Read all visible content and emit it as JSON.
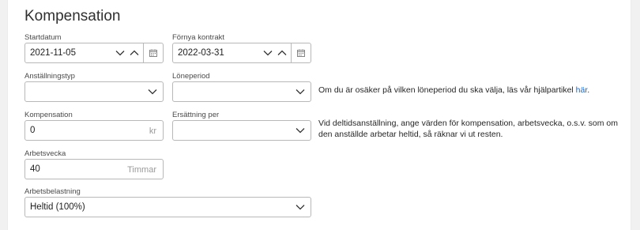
{
  "section": {
    "title": "Kompensation"
  },
  "fields": {
    "startdatum": {
      "label": "Startdatum",
      "value": "2021-11-05"
    },
    "fornya_kontrakt": {
      "label": "Förnya kontrakt",
      "value": "2022-03-31"
    },
    "anstallningstyp": {
      "label": "Anställningstyp",
      "value": ""
    },
    "loneperiod": {
      "label": "Löneperiod",
      "value": ""
    },
    "kompensation": {
      "label": "Kompensation",
      "value": "0",
      "suffix": "kr"
    },
    "ersattning_per": {
      "label": "Ersättning per",
      "value": ""
    },
    "arbetsvecka": {
      "label": "Arbetsvecka",
      "value": "40",
      "suffix": "Timmar"
    },
    "arbetsbelastning": {
      "label": "Arbetsbelastning",
      "value": "Heltid (100%)"
    }
  },
  "help": {
    "loneperiod_text": "Om du är osäker på vilken löneperiod du ska välja, läs vår hjälpartikel ",
    "loneperiod_link": "här",
    "loneperiod_end": ".",
    "deltid_line1": "Vid deltidsanställning, ange värden för kompensation, arbetsvecka, o.s.v. som om",
    "deltid_line2": "den anställde arbetar heltid, så räknar vi ut resten."
  },
  "icons": {
    "chevron_down": "chevron-down-icon",
    "chevron_up": "chevron-up-icon",
    "calendar": "calendar-icon"
  },
  "colors": {
    "link": "#1a66c9",
    "border": "#b8b8b8",
    "background": "#f1f1f2"
  }
}
